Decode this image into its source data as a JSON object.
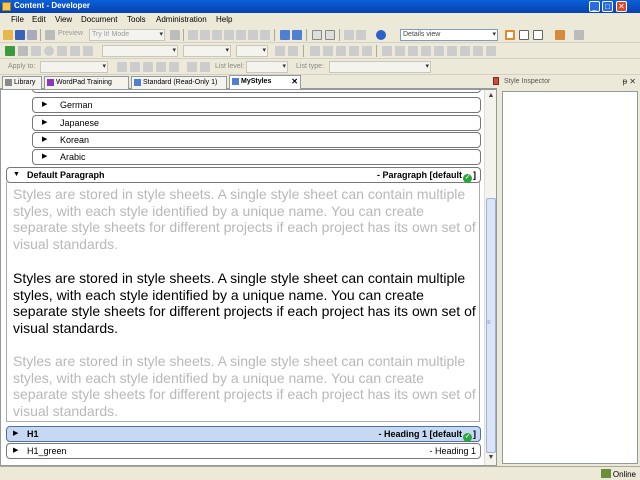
{
  "window": {
    "title": "Content - Developer",
    "min": "_",
    "max": "□",
    "close": "✕"
  },
  "menu": [
    "File",
    "Edit",
    "View",
    "Document",
    "Tools",
    "Administration",
    "Help"
  ],
  "toolbar1": {
    "preview_label": "Preview",
    "mode_select": "Try It! Mode",
    "view_select": "Details view"
  },
  "toolbar3": {
    "apply_to_label": "Apply to:",
    "list_level_label": "List level:",
    "list_type_label": "List type:"
  },
  "tabs": [
    {
      "label": "Library",
      "icon": "library-icon"
    },
    {
      "label": "WordPad Training",
      "icon": "wordpad-doc-icon"
    },
    {
      "label": "Standard (Read-Only 1)",
      "icon": "stylesheet-icon"
    },
    {
      "label": "MyStyles",
      "icon": "stylesheet-icon",
      "close": "✕"
    }
  ],
  "style_list": {
    "languages": [
      "German",
      "Japanese",
      "Korean",
      "Arabic"
    ],
    "default_paragraph": {
      "name": "Default Paragraph",
      "type_prefix": "- Paragraph [default",
      "type_suffix": "]"
    },
    "sample_text": "Styles are stored in style sheets. A single style sheet can contain multiple styles, with each style identified by a unique name. You can create separate style sheets for different projects if each project has its own set of visual standards.",
    "h1": {
      "name": "H1",
      "type_prefix": "- Heading 1 [default",
      "type_suffix": "]"
    },
    "h1_green": {
      "name": "H1_green",
      "type": "- Heading 1"
    }
  },
  "inspector": {
    "title": "Style Inspector",
    "pin": "ᵽ",
    "close": "✕"
  },
  "status": {
    "online": "Online"
  },
  "colors": {
    "titlebar": "#0a5fd8",
    "selected_row": "#c6d8f2",
    "default_ok": "#2aa63c",
    "grey_text": "#b8b8b8"
  }
}
